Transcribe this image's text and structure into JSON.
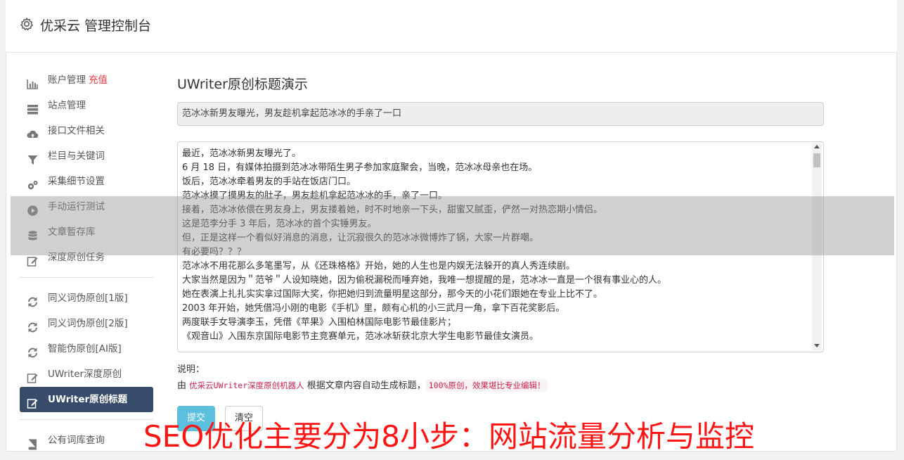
{
  "header": {
    "title": "优采云 管理控制台",
    "icon": "gear-icon"
  },
  "sidebar": {
    "items": [
      {
        "label": "账户管理",
        "badge": "充值",
        "icon": "bar-chart-icon"
      },
      {
        "label": "站点管理",
        "icon": "server-icon"
      },
      {
        "label": "接口文件相关",
        "icon": "cloud-upload-icon"
      },
      {
        "label": "栏目与关键词",
        "icon": "filter-icon"
      },
      {
        "label": "采集细节设置",
        "icon": "gears-icon"
      },
      {
        "label": "手动运行测试",
        "icon": "play-circle-icon"
      },
      {
        "label": "文章暂存库",
        "icon": "database-icon"
      },
      {
        "label": "深度原创任务",
        "icon": "edit-icon"
      },
      {
        "label": "同义词伪原创[1版]",
        "icon": "refresh-icon"
      },
      {
        "label": "同义词伪原创[2版]",
        "icon": "refresh-icon"
      },
      {
        "label": "智能伪原创[AI版]",
        "icon": "refresh-icon"
      },
      {
        "label": "UWriter深度原创",
        "icon": "edit-icon"
      },
      {
        "label": "UWriter原创标题",
        "icon": "edit-icon",
        "active": true
      },
      {
        "label": "公有词库查询",
        "icon": "book-icon"
      }
    ]
  },
  "main": {
    "heading": "UWriter原创标题演示",
    "title_value": "范冰冰新男友曝光，男友趁机拿起范冰冰的手亲了一口",
    "content_lines": [
      "最近，范冰冰新男友曝光了。",
      "6 月 18 日，有媒体拍摄到范冰冰带陌生男子参加家庭聚会，当晚，范冰冰母亲也在场。",
      "饭后，范冰冰牵着男友的手站在饭店门口。",
      "范冰冰摸了摸男友的肚子，男友趁机拿起范冰冰的手，亲了一口。",
      "接着，范冰冰依偎在男友身上，男友搂着她，时不时地亲一下头，甜蜜又腻歪，俨然一对热恋期小情侣。",
      "这是范李分手 3 年后，范冰冰的首个实锤男友。",
      "但，正是这样一个看似好消息的消息，让沉寂很久的范冰冰微博炸了锅，大家一片群嘲。",
      "有必要吗？？？",
      "范冰冰不用花那么多笔墨写，从《还珠格格》开始，她的人生也是内娱无法躲开的真人秀连续剧。",
      "大家当然是因为＂范爷＂人设知晓她，因为偷税漏税而唾弃她，我唯一想提醒的是，范冰冰一直是一个很有事业心的人。",
      "她在表演上扎扎实实拿过国际大奖，你把她归到流量明星这部分，那今天的小花们跟她在专业上比不了。",
      "2003 年开始，她凭借冯小刚的电影《手机》里，颇有心机的小三武月一角，拿下百花奖影后。",
      "两度联手女导演李玉，凭借《苹果》入围柏林国际电影节最佳影片；",
      "《观音山》入围东京国际电影节主竞赛单元，范冰冰斩获北京大学生电影节最佳女演员。"
    ],
    "explain_label": "说明：",
    "explain_prefix": "由",
    "explain_code1": "优采云UWriter深度原创机器人",
    "explain_middle": "根据文章内容自动生成标题，",
    "explain_code2": "100%原创，效果堪比专业编辑！",
    "submit_label": "提交",
    "clear_label": "清空"
  },
  "banner": {
    "text": "SEO优化主要分为8小步：网站流量分析与监控"
  },
  "colors": {
    "active_nav": "#374b6a",
    "badge": "#e4393c",
    "submit": "#5bc0de",
    "banner": "#ff1414"
  }
}
